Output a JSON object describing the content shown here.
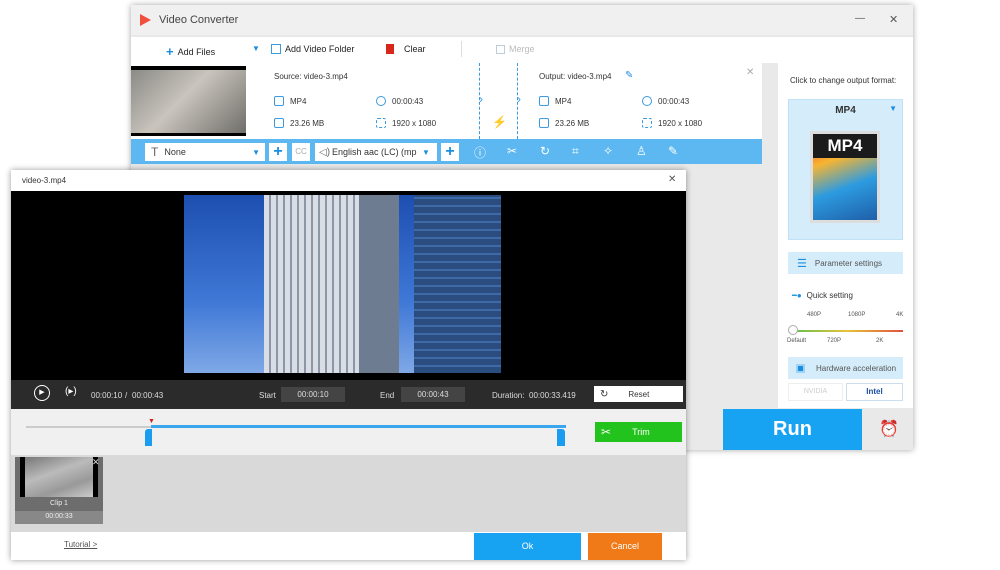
{
  "app": {
    "title": "Video Converter",
    "minimize": "—",
    "close": "✕"
  },
  "toolbar": {
    "add_files": "Add Files",
    "add_folder": "Add Video Folder",
    "clear": "Clear",
    "merge": "Merge"
  },
  "file": {
    "source_label": "Source: video-3.mp4",
    "source": {
      "format": "MP4",
      "duration": "00:00:43",
      "size": "23.26 MB",
      "resolution": "1920 x 1080"
    },
    "output_label": "Output: video-3.mp4",
    "output": {
      "format": "MP4",
      "duration": "00:00:43",
      "size": "23.26 MB",
      "resolution": "1920 x 1080"
    },
    "subtitle": "None",
    "subtitle_cc": "CC",
    "audio": "English aac (LC) (mp"
  },
  "right_panel": {
    "prompt": "Click to change output format:",
    "format": "MP4",
    "format_icon_text": "MP4",
    "param_settings": "Parameter settings",
    "quick_setting": "Quick setting",
    "quality_top": [
      "480P",
      "1080P",
      "4K"
    ],
    "quality_bottom": [
      "Default",
      "720P",
      "2K"
    ],
    "quality_level": 0,
    "hw_accel": "Hardware acceleration",
    "nvidia": "NVIDIA",
    "intel": "Intel"
  },
  "run": "Run",
  "trim": {
    "title": "video-3.mp4",
    "close": "✕",
    "time_current": "00:00:10",
    "time_sep": "/",
    "time_total": "00:00:43",
    "start_label": "Start",
    "start": "00:00:10",
    "end_label": "End",
    "end": "00:00:43",
    "duration_label": "Duration:",
    "duration": "00:00:33.419",
    "reset": "Reset",
    "trim_btn": "Trim",
    "clip": {
      "name": "Clip 1",
      "length": "00:00:33"
    },
    "tutorial": "Tutorial >",
    "ok": "Ok",
    "cancel": "Cancel"
  },
  "colors": {
    "accent": "#18a2f2",
    "trim": "#22c31c",
    "cancel": "#f07a17",
    "strip": "#5db7f0"
  }
}
